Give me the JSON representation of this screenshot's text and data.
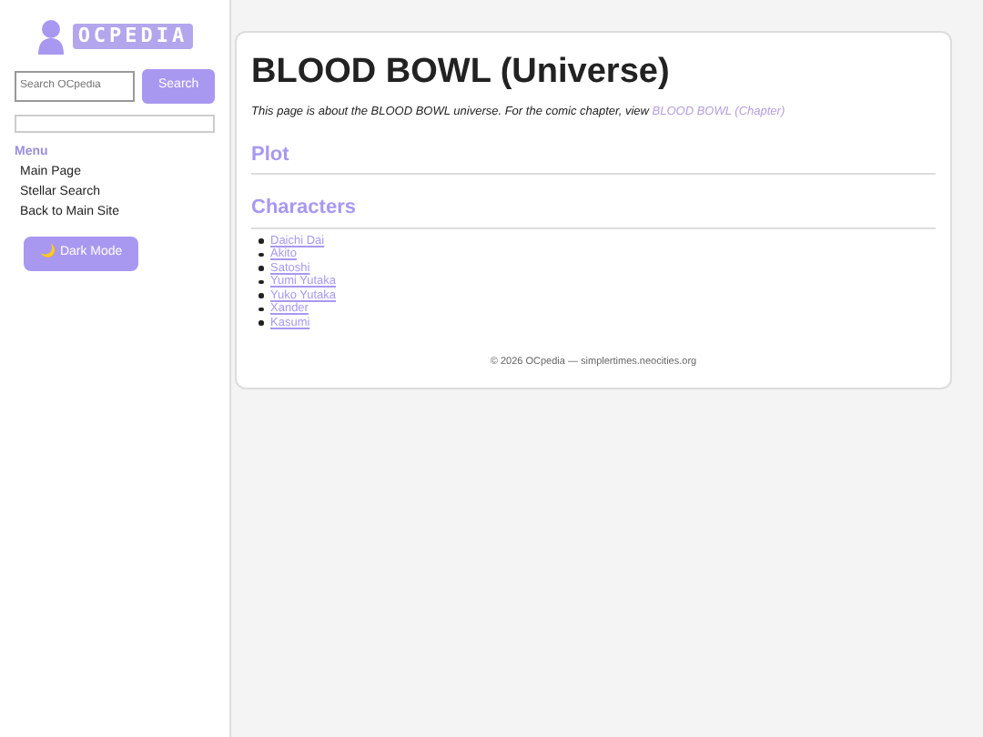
{
  "logo": {
    "text": "OCPEDIA"
  },
  "search": {
    "placeholder": "Search OCpedia",
    "button": "Search"
  },
  "menu": {
    "heading": "Menu",
    "items": [
      "Main Page",
      "Stellar Search",
      "Back to Main Site"
    ]
  },
  "dark_mode_button": {
    "icon": "🌙",
    "label": "Dark Mode"
  },
  "article": {
    "title": "BLOOD BOWL (Universe)",
    "note": "This page is about the BLOOD BOWL universe. For the comic chapter, view ",
    "note_link": "BLOOD BOWL (Chapter)",
    "sections": [
      {
        "heading": "Plot"
      },
      {
        "heading": "Characters",
        "links": [
          "Daichi Dai",
          "Akito",
          "Satoshi",
          "Yumi Yutaka",
          "Yuko Yutaka",
          "Xander",
          "Kasumi"
        ]
      }
    ]
  },
  "footer": "© 2026 OCpedia — simplertimes.neocities.org"
}
